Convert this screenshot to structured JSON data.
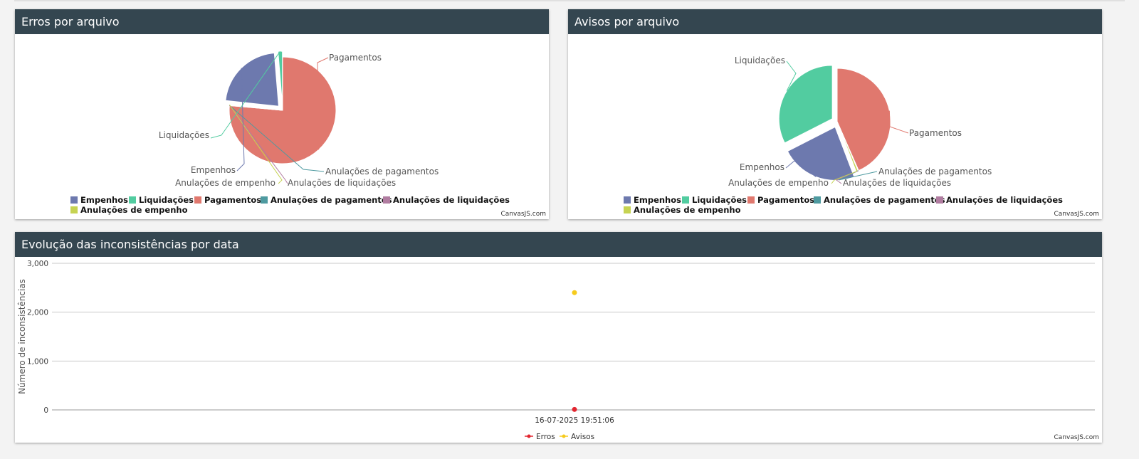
{
  "credit": "CanvasJS.com",
  "panels": {
    "errors": {
      "title": "Erros por arquivo"
    },
    "warnings": {
      "title": "Avisos por arquivo"
    },
    "evolution": {
      "title": "Evolução das inconsistências por data"
    }
  },
  "colors": {
    "empenhos": "#6d79ae",
    "liquidacoes": "#52cca0",
    "pagamentos": "#e0786e",
    "anul_pagamentos": "#4e9aa0",
    "anul_liquidacoes": "#b07ca0",
    "anul_empenho": "#c6d352",
    "erros": "#e2252f",
    "avisos": "#f6cb1c"
  },
  "chart_data": [
    {
      "type": "pie",
      "title": "Erros por arquivo",
      "legend": [
        "Empenhos",
        "Liquidações",
        "Pagamentos",
        "Anulações de pagamentos",
        "Anulações de liquidações",
        "Anulações de empenho"
      ],
      "legend_position": "bottom",
      "slices": [
        {
          "label": "Pagamentos",
          "value": 76.4,
          "exploded": false
        },
        {
          "label": "Anulações de pagamentos",
          "value": 0.1,
          "exploded": false
        },
        {
          "label": "Anulações de liquidações",
          "value": 0.1,
          "exploded": false
        },
        {
          "label": "Anulações de empenho",
          "value": 0.1,
          "exploded": false
        },
        {
          "label": "Empenhos",
          "value": 22.0,
          "exploded": true
        },
        {
          "label": "Liquidações",
          "value": 1.3,
          "exploded": true
        }
      ]
    },
    {
      "type": "pie",
      "title": "Avisos por arquivo",
      "legend": [
        "Empenhos",
        "Liquidações",
        "Pagamentos",
        "Anulações de pagamentos",
        "Anulações de liquidações",
        "Anulações de empenho"
      ],
      "legend_position": "bottom",
      "slices": [
        {
          "label": "Pagamentos",
          "value": 43.4,
          "exploded": false
        },
        {
          "label": "Anulações de pagamentos",
          "value": 0.1,
          "exploded": false
        },
        {
          "label": "Anulações de liquidações",
          "value": 0.1,
          "exploded": false
        },
        {
          "label": "Anulações de empenho",
          "value": 0.6,
          "exploded": false
        },
        {
          "label": "Empenhos",
          "value": 23.3,
          "exploded": true
        },
        {
          "label": "Liquidações",
          "value": 32.5,
          "exploded": true
        }
      ]
    },
    {
      "type": "scatter",
      "title": "Evolução das inconsistências por data",
      "ylabel": "Número de inconsistências",
      "ylim": [
        0,
        3000
      ],
      "yticks": [
        "0",
        "1,000",
        "2,000",
        "3,000"
      ],
      "xticks": [
        "16-07-2025 19:51:06"
      ],
      "grid": true,
      "legend_position": "bottom",
      "series": [
        {
          "name": "Erros",
          "points": [
            {
              "x": "16-07-2025 19:51:06",
              "y": 10
            }
          ]
        },
        {
          "name": "Avisos",
          "points": [
            {
              "x": "16-07-2025 19:51:06",
              "y": 2400
            }
          ]
        }
      ]
    }
  ]
}
